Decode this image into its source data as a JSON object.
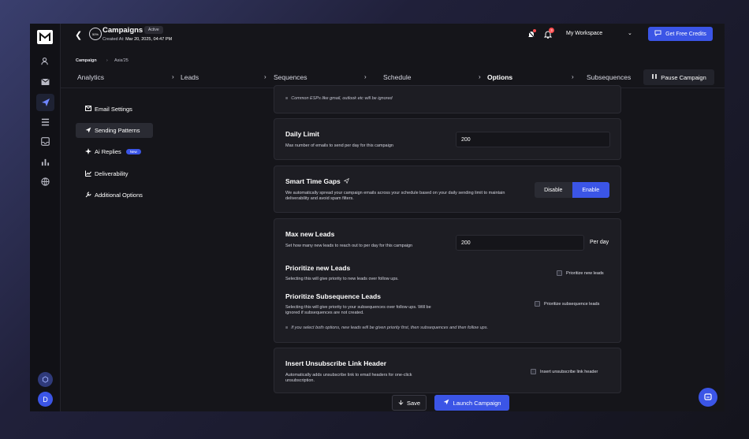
{
  "topbar": {
    "progress": "50%",
    "campaign_title": "Campaigns",
    "status": "Active",
    "created_label": "Created At:",
    "created_value": "Mar 20, 2025, 04:47 PM",
    "notification_count": "3",
    "workspace": "My Workspace",
    "credits_button": "Get Free Credits"
  },
  "breadcrumb": {
    "root": "Campaign",
    "current": "Asia'25"
  },
  "steps": [
    "Analytics",
    "Leads",
    "Sequences",
    "Schedule",
    "Options",
    "Subsequences"
  ],
  "active_step": "Options",
  "pause_button": "Pause Campaign",
  "settings_nav": [
    {
      "label": "Email Settings"
    },
    {
      "label": "Sending Patterns"
    },
    {
      "label": "Ai Replies",
      "badge": "New"
    },
    {
      "label": "Deliverability"
    },
    {
      "label": "Additional Options"
    }
  ],
  "esp_note": "Common ESPs like gmail, outlook etc will be ignored",
  "daily_limit": {
    "title": "Daily Limit",
    "description": "Max number of emails to send per day for this campaign",
    "value": "200"
  },
  "time_gaps": {
    "title": "Smart Time Gaps",
    "description": "We automatically spread your campaign emails across your schedule based on your daily sending limit to maintain deliverability and avoid spam filters.",
    "disable": "Disable",
    "enable": "Enable"
  },
  "max_leads": {
    "title": "Max new Leads",
    "description": "Set how many new leads to reach out to per day for this campaign",
    "value": "200",
    "unit": "Per day"
  },
  "prioritize_new": {
    "title": "Prioritize new Leads",
    "description": "Selecting this will give priority to new leads over follow ups.",
    "checkbox": "Prioritize new leads"
  },
  "prioritize_sub": {
    "title": "Prioritize Subsequence Leads",
    "description": "Selecting this will give priority to your subsequences over follow ups. Will be ignored if subsequences are not created.",
    "checkbox": "Prioritize subsequence leads",
    "note": "If you select both options, new leads will be given priority first, then subsequences and then follow ups."
  },
  "unsubscribe": {
    "title": "Insert Unsubscribe Link Header",
    "description": "Automatically adds unsubscribe link to email headers for one-click unsubscription.",
    "checkbox": "Insert unsubscribe link header"
  },
  "footer": {
    "save": "Save",
    "launch": "Launch Campaign"
  },
  "user_initial": "D",
  "colors": {
    "accent": "#3b55e6",
    "background": "#15151a",
    "card": "#1d1d23"
  }
}
